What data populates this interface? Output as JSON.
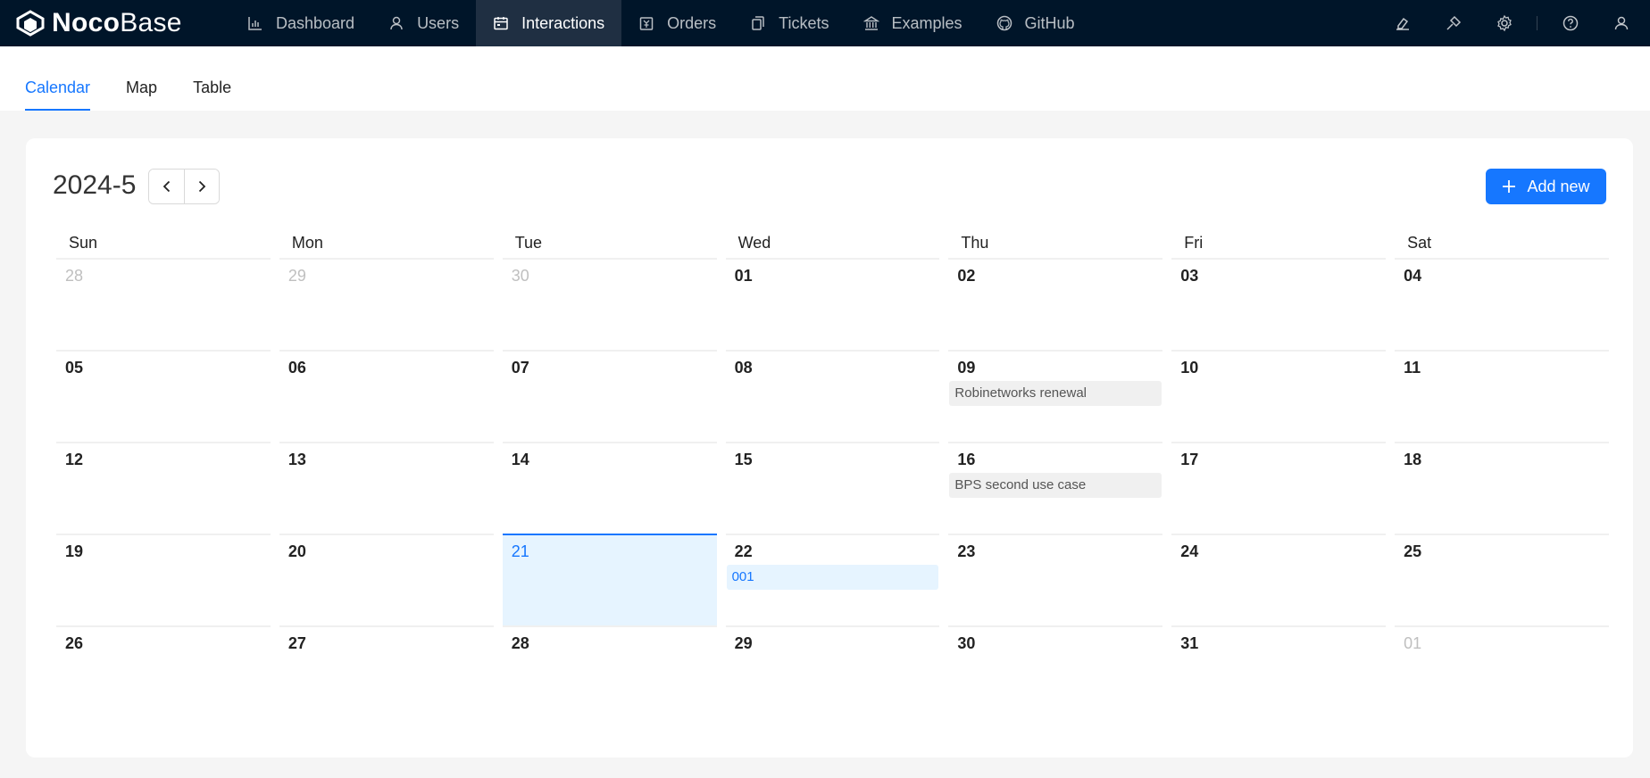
{
  "app": {
    "logo_bold": "Noco",
    "logo_light": "Base"
  },
  "nav": [
    {
      "label": "Dashboard",
      "icon": "bar-chart-icon",
      "active": false
    },
    {
      "label": "Users",
      "icon": "user-icon",
      "active": false
    },
    {
      "label": "Interactions",
      "icon": "calendar-icon",
      "active": true
    },
    {
      "label": "Orders",
      "icon": "order-icon",
      "active": false
    },
    {
      "label": "Tickets",
      "icon": "copy-icon",
      "active": false
    },
    {
      "label": "Examples",
      "icon": "bank-icon",
      "active": false
    },
    {
      "label": "GitHub",
      "icon": "github-icon",
      "active": false
    }
  ],
  "right_icons": [
    "highlight-icon",
    "plugin-icon",
    "settings-icon",
    "help-icon",
    "user-avatar-icon"
  ],
  "tabs": [
    {
      "label": "Calendar",
      "active": true
    },
    {
      "label": "Map",
      "active": false
    },
    {
      "label": "Table",
      "active": false
    }
  ],
  "calendar": {
    "title": "2024-5",
    "add_label": "Add new",
    "weekdays": [
      "Sun",
      "Mon",
      "Tue",
      "Wed",
      "Thu",
      "Fri",
      "Sat"
    ],
    "weeks": [
      [
        {
          "d": "28",
          "muted": true
        },
        {
          "d": "29",
          "muted": true
        },
        {
          "d": "30",
          "muted": true
        },
        {
          "d": "01"
        },
        {
          "d": "02"
        },
        {
          "d": "03"
        },
        {
          "d": "04"
        }
      ],
      [
        {
          "d": "05"
        },
        {
          "d": "06"
        },
        {
          "d": "07"
        },
        {
          "d": "08"
        },
        {
          "d": "09",
          "event": "Robinetworks renewal"
        },
        {
          "d": "10"
        },
        {
          "d": "11"
        }
      ],
      [
        {
          "d": "12"
        },
        {
          "d": "13"
        },
        {
          "d": "14"
        },
        {
          "d": "15"
        },
        {
          "d": "16",
          "event": "BPS second use case"
        },
        {
          "d": "17"
        },
        {
          "d": "18"
        }
      ],
      [
        {
          "d": "19"
        },
        {
          "d": "20"
        },
        {
          "d": "21",
          "today": true
        },
        {
          "d": "22",
          "event": "001",
          "event_blue": true
        },
        {
          "d": "23"
        },
        {
          "d": "24"
        },
        {
          "d": "25"
        }
      ],
      [
        {
          "d": "26"
        },
        {
          "d": "27"
        },
        {
          "d": "28"
        },
        {
          "d": "29"
        },
        {
          "d": "30"
        },
        {
          "d": "31"
        },
        {
          "d": "01",
          "muted": true
        }
      ]
    ]
  },
  "colors": {
    "topbar": "#001529",
    "accent": "#1677ff",
    "today_bg": "#e6f4ff"
  }
}
